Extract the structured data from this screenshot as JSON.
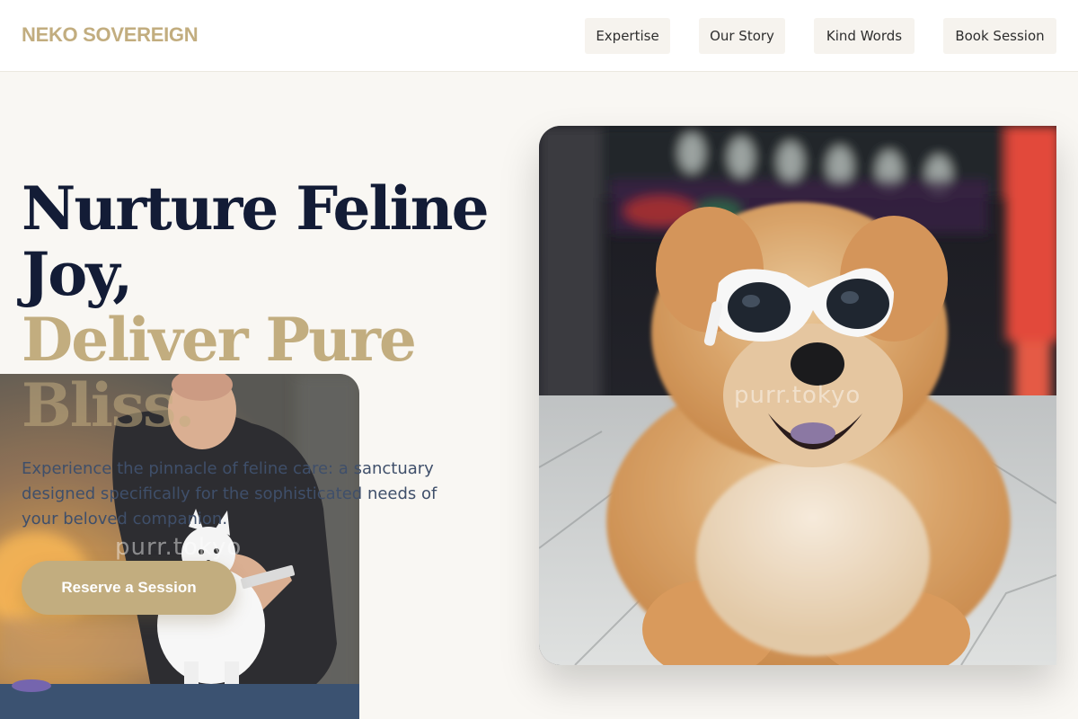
{
  "brand": {
    "name": "NEKO SOVEREIGN"
  },
  "nav": {
    "items": [
      {
        "label": "Expertise"
      },
      {
        "label": "Our Story"
      },
      {
        "label": "Kind Words"
      },
      {
        "label": "Book Session"
      }
    ]
  },
  "hero": {
    "headline_line1": "Nurture Feline",
    "headline_line2": "Joy,",
    "headline_line3": "Deliver Pure",
    "headline_line4": "Bliss.",
    "subtext": "Experience the pinnacle of feline care: a sanctuary designed specifically for the sophisticated needs of your beloved companion.",
    "cta_label": "Reserve a Session"
  },
  "watermarks": {
    "main_photo": "purr.tokyo",
    "groom_photo": "purr.tokyo"
  },
  "colors": {
    "accent_gold": "#c2ad7f",
    "headline_navy": "#131c36",
    "body_slate": "#3f4f6a",
    "page_bg": "#f9f7f3"
  }
}
